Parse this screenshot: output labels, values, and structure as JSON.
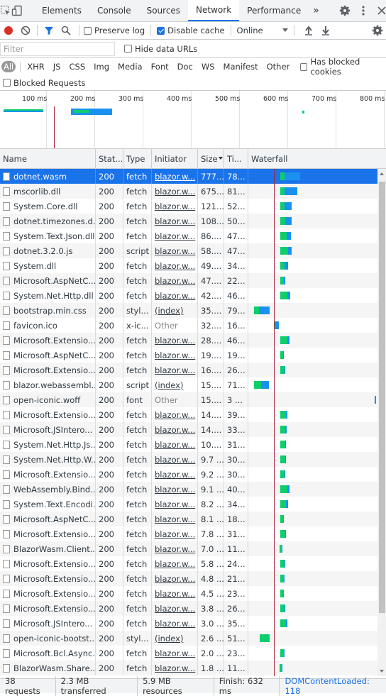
{
  "tabs": {
    "items": [
      "Elements",
      "Console",
      "Sources",
      "Network",
      "Performance"
    ],
    "active": "Network",
    "more": "»"
  },
  "toolbar": {
    "preserve_log": "Preserve log",
    "disable_cache": "Disable cache",
    "throttling": "Online"
  },
  "filter": {
    "placeholder": "Filter",
    "hide_data_urls": "Hide data URLs"
  },
  "types": {
    "items": [
      "All",
      "XHR",
      "JS",
      "CSS",
      "Img",
      "Media",
      "Font",
      "Doc",
      "WS",
      "Manifest",
      "Other"
    ],
    "has_blocked": "Has blocked cookies"
  },
  "blocked_requests": "Blocked Requests",
  "overview": {
    "ticks": [
      "100 ms",
      "200 ms",
      "300 ms",
      "400 ms",
      "500 ms",
      "600 ms",
      "700 ms",
      "800 ms"
    ]
  },
  "columns": {
    "name": "Name",
    "status": "Stat...",
    "type": "Type",
    "initiator": "Initiator",
    "size": "Size",
    "time": "Ti...",
    "waterfall": "Waterfall"
  },
  "rows": [
    {
      "name": "dotnet.wasm",
      "status": "200",
      "type": "fetch",
      "initiator": "blazor.w...",
      "size": "777...",
      "time": "78...",
      "wf": [
        [
          395,
          3,
          0
        ],
        [
          398,
          3,
          0
        ],
        [
          401,
          22,
          1
        ]
      ]
    },
    {
      "name": "mscorlib.dll",
      "status": "200",
      "type": "fetch",
      "initiator": "blazor.w...",
      "size": "675...",
      "time": "81...",
      "wf": [
        [
          395,
          3,
          0
        ],
        [
          398,
          3,
          0
        ],
        [
          401,
          18,
          1
        ]
      ]
    },
    {
      "name": "System.Core.dll",
      "status": "200",
      "type": "fetch",
      "initiator": "blazor.w...",
      "size": "121...",
      "time": "52...",
      "wf": [
        [
          395,
          2,
          0
        ],
        [
          397,
          4,
          0
        ],
        [
          401,
          10,
          1
        ]
      ]
    },
    {
      "name": "dotnet.timezones.d...",
      "status": "200",
      "type": "fetch",
      "initiator": "blazor.w...",
      "size": "108...",
      "time": "50...",
      "wf": [
        [
          395,
          2,
          0
        ],
        [
          397,
          5,
          0
        ],
        [
          402,
          9,
          1
        ]
      ]
    },
    {
      "name": "System.Text.Json.dll",
      "status": "200",
      "type": "fetch",
      "initiator": "blazor.w...",
      "size": "86....",
      "time": "47...",
      "wf": [
        [
          395,
          2,
          0
        ],
        [
          397,
          7,
          0
        ],
        [
          404,
          6,
          1
        ]
      ]
    },
    {
      "name": "dotnet.3.2.0.js",
      "status": "200",
      "type": "script",
      "initiator": "blazor.w...",
      "size": "58....",
      "time": "47...",
      "wf": [
        [
          395,
          2,
          0
        ],
        [
          397,
          9,
          0
        ],
        [
          406,
          5,
          1
        ]
      ]
    },
    {
      "name": "System.dll",
      "status": "200",
      "type": "fetch",
      "initiator": "blazor.w...",
      "size": "49....",
      "time": "34...",
      "wf": [
        [
          395,
          2,
          0
        ],
        [
          397,
          4,
          0
        ],
        [
          401,
          5,
          1
        ]
      ]
    },
    {
      "name": "Microsoft.AspNetC...",
      "status": "200",
      "type": "fetch",
      "initiator": "blazor.w...",
      "size": "47....",
      "time": "22...",
      "wf": [
        [
          395,
          1,
          0
        ],
        [
          396,
          4,
          0
        ],
        [
          400,
          2,
          1
        ]
      ]
    },
    {
      "name": "System.Net.Http.dll",
      "status": "200",
      "type": "fetch",
      "initiator": "blazor.w...",
      "size": "42....",
      "time": "46...",
      "wf": [
        [
          395,
          2,
          0
        ],
        [
          397,
          8,
          0
        ],
        [
          405,
          4,
          1
        ]
      ]
    },
    {
      "name": "bootstrap.min.css",
      "status": "200",
      "type": "styl...",
      "initiator": "(index)",
      "size": "35....",
      "time": "79...",
      "wf": [
        [
          358,
          2,
          0
        ],
        [
          360,
          5,
          0
        ],
        [
          365,
          15,
          1
        ]
      ]
    },
    {
      "name": "favicon.ico",
      "status": "200",
      "type": "x-ic...",
      "initiator": "Other",
      "size": "32....",
      "time": "16...",
      "wf": [
        [
          387,
          1,
          0
        ],
        [
          388,
          5,
          1
        ]
      ]
    },
    {
      "name": "Microsoft.Extensio...",
      "status": "200",
      "type": "fetch",
      "initiator": "blazor.w...",
      "size": "28....",
      "time": "46...",
      "wf": [
        [
          395,
          2,
          0
        ],
        [
          397,
          8,
          0
        ],
        [
          405,
          3,
          1
        ]
      ]
    },
    {
      "name": "Microsoft.AspNetC...",
      "status": "200",
      "type": "fetch",
      "initiator": "blazor.w...",
      "size": "19....",
      "time": "19...",
      "wf": [
        [
          395,
          1,
          0
        ],
        [
          396,
          3,
          0
        ],
        [
          399,
          1,
          1
        ]
      ]
    },
    {
      "name": "Microsoft.Extensio...",
      "status": "200",
      "type": "fetch",
      "initiator": "blazor.w...",
      "size": "16....",
      "time": "26...",
      "wf": [
        [
          395,
          2,
          0
        ],
        [
          397,
          4,
          0
        ],
        [
          401,
          1,
          1
        ]
      ]
    },
    {
      "name": "blazor.webassembl...",
      "status": "200",
      "type": "script",
      "initiator": "(index)",
      "size": "15....",
      "time": "71...",
      "wf": [
        [
          358,
          2,
          0
        ],
        [
          360,
          8,
          0
        ],
        [
          368,
          11,
          1
        ]
      ]
    },
    {
      "name": "open-iconic.woff",
      "status": "200",
      "type": "font",
      "initiator": "Other",
      "size": "15....",
      "time": "3 ...",
      "wf": [
        [
          528,
          2,
          1
        ]
      ]
    },
    {
      "name": "Microsoft.Extensio...",
      "status": "200",
      "type": "fetch",
      "initiator": "blazor.w...",
      "size": "14....",
      "time": "39...",
      "wf": [
        [
          395,
          2,
          0
        ],
        [
          397,
          6,
          0
        ],
        [
          403,
          2,
          1
        ]
      ]
    },
    {
      "name": "Microsoft.JSIntero...",
      "status": "200",
      "type": "fetch",
      "initiator": "blazor.w...",
      "size": "14....",
      "time": "33...",
      "wf": [
        [
          395,
          2,
          0
        ],
        [
          397,
          5,
          0
        ],
        [
          402,
          2,
          1
        ]
      ]
    },
    {
      "name": "System.Net.Http.Js...",
      "status": "200",
      "type": "fetch",
      "initiator": "blazor.w...",
      "size": "10....",
      "time": "31...",
      "wf": [
        [
          395,
          2,
          0
        ],
        [
          397,
          5,
          0
        ],
        [
          402,
          1,
          1
        ]
      ]
    },
    {
      "name": "System.Net.Http.W...",
      "status": "200",
      "type": "fetch",
      "initiator": "blazor.w...",
      "size": "9.7 ...",
      "time": "30...",
      "wf": [
        [
          395,
          2,
          0
        ],
        [
          397,
          5,
          0
        ],
        [
          402,
          1,
          1
        ]
      ]
    },
    {
      "name": "Microsoft.Extensio...",
      "status": "200",
      "type": "fetch",
      "initiator": "blazor.w...",
      "size": "9.2 ...",
      "time": "30...",
      "wf": [
        [
          395,
          2,
          0
        ],
        [
          397,
          4,
          0
        ],
        [
          401,
          1,
          1
        ]
      ]
    },
    {
      "name": "WebAssembly.Bind...",
      "status": "200",
      "type": "fetch",
      "initiator": "blazor.w...",
      "size": "9.1 ...",
      "time": "40...",
      "wf": [
        [
          395,
          2,
          0
        ],
        [
          397,
          8,
          0
        ],
        [
          405,
          3,
          1
        ]
      ]
    },
    {
      "name": "System.Text.Encodi...",
      "status": "200",
      "type": "fetch",
      "initiator": "blazor.w...",
      "size": "8.2 ...",
      "time": "34...",
      "wf": [
        [
          395,
          2,
          0
        ],
        [
          397,
          6,
          0
        ],
        [
          403,
          3,
          1
        ]
      ]
    },
    {
      "name": "Microsoft.AspNetC...",
      "status": "200",
      "type": "fetch",
      "initiator": "blazor.w...",
      "size": "8.1 ...",
      "time": "18...",
      "wf": [
        [
          395,
          1,
          0
        ],
        [
          396,
          3,
          0
        ],
        [
          399,
          1,
          1
        ]
      ]
    },
    {
      "name": "Microsoft.Extensio...",
      "status": "200",
      "type": "fetch",
      "initiator": "blazor.w...",
      "size": "7.8 ...",
      "time": "31...",
      "wf": [
        [
          395,
          2,
          0
        ],
        [
          397,
          5,
          0
        ],
        [
          402,
          1,
          1
        ]
      ]
    },
    {
      "name": "BlazorWasm.Client....",
      "status": "200",
      "type": "fetch",
      "initiator": "blazor.w...",
      "size": "7.0 ...",
      "time": "11...",
      "wf": [
        [
          394,
          1,
          0
        ],
        [
          395,
          2,
          0
        ],
        [
          397,
          1,
          1
        ]
      ]
    },
    {
      "name": "Microsoft.Extensio...",
      "status": "200",
      "type": "fetch",
      "initiator": "blazor.w...",
      "size": "5.8 ...",
      "time": "24...",
      "wf": [
        [
          395,
          2,
          0
        ],
        [
          397,
          4,
          0
        ],
        [
          401,
          1,
          1
        ]
      ]
    },
    {
      "name": "Microsoft.Extensio...",
      "status": "200",
      "type": "fetch",
      "initiator": "blazor.w...",
      "size": "4.8 ...",
      "time": "21...",
      "wf": [
        [
          395,
          2,
          0
        ],
        [
          397,
          3,
          0
        ],
        [
          400,
          1,
          1
        ]
      ]
    },
    {
      "name": "Microsoft.Extensio...",
      "status": "200",
      "type": "fetch",
      "initiator": "blazor.w...",
      "size": "4.5 ...",
      "time": "23...",
      "wf": [
        [
          395,
          1,
          0
        ],
        [
          396,
          3,
          0
        ],
        [
          399,
          1,
          1
        ]
      ]
    },
    {
      "name": "Microsoft.Extensio...",
      "status": "200",
      "type": "fetch",
      "initiator": "blazor.w...",
      "size": "3.8 ...",
      "time": "26...",
      "wf": [
        [
          395,
          2,
          0
        ],
        [
          397,
          4,
          0
        ],
        [
          401,
          1,
          1
        ]
      ]
    },
    {
      "name": "Microsoft.JSIntero...",
      "status": "200",
      "type": "fetch",
      "initiator": "blazor.w...",
      "size": "3.0 ...",
      "time": "35...",
      "wf": [
        [
          395,
          2,
          0
        ],
        [
          397,
          6,
          0
        ],
        [
          403,
          2,
          1
        ]
      ]
    },
    {
      "name": "open-iconic-bootst...",
      "status": "200",
      "type": "styl...",
      "initiator": "(index)",
      "size": "2.6 ...",
      "time": "51...",
      "wf": [
        [
          366,
          14,
          0
        ]
      ]
    },
    {
      "name": "Microsoft.Bcl.Async...",
      "status": "200",
      "type": "fetch",
      "initiator": "blazor.w...",
      "size": "2.0 ...",
      "time": "23...",
      "wf": [
        [
          395,
          1,
          0
        ],
        [
          396,
          4,
          0
        ],
        [
          400,
          1,
          1
        ]
      ]
    },
    {
      "name": "BlazorWasm.Share...",
      "status": "200",
      "type": "fetch",
      "initiator": "blazor.w...",
      "size": "1.8 ...",
      "time": "11...",
      "wf": [
        [
          394,
          1,
          0
        ],
        [
          395,
          2,
          0
        ],
        [
          397,
          1,
          1
        ]
      ]
    }
  ],
  "status": {
    "requests": "38 requests",
    "transferred": "2.3 MB transferred",
    "resources": "5.9 MB resources",
    "finish": "Finish: 632 ms",
    "dcl": "DOMContentLoaded: 118"
  }
}
